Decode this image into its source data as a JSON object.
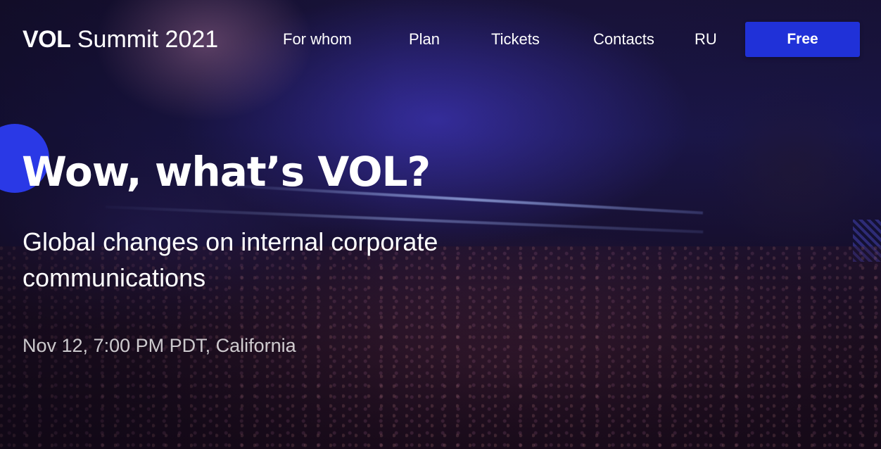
{
  "header": {
    "logo_bold": "VOL",
    "logo_light": "Summit 2021",
    "nav": [
      {
        "label": "For whom"
      },
      {
        "label": "Plan"
      },
      {
        "label": "Tickets"
      },
      {
        "label": "Contacts"
      }
    ],
    "language": "RU",
    "cta_label": "Free"
  },
  "hero": {
    "headline": "Wow, what’s VOL?",
    "subheadline": "Global changes on internal corporate communications",
    "date_location": "Nov 12, 7:00 PM PDT, California"
  },
  "colors": {
    "accent": "#2031d8",
    "text": "#ffffff"
  }
}
